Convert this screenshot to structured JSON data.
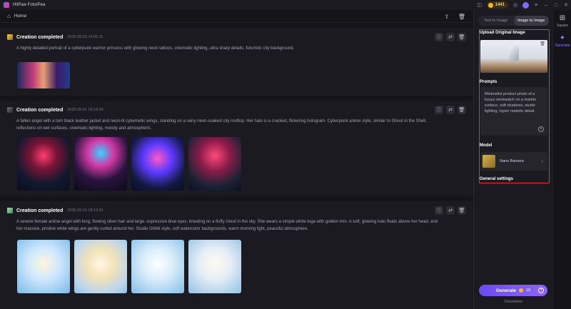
{
  "window": {
    "title": "HitPaw FotorPea",
    "credits": "1441"
  },
  "header": {
    "home_label": "Home"
  },
  "feed": {
    "cards": [
      {
        "title": "Creation completed",
        "time": "2025.09.03  14:55:11",
        "prompt": "A highly detailed portrait of a cyberpunk warrior princess with glowing neon tattoos, cinematic lighting, ultra sharp details, futuristic city background."
      },
      {
        "title": "Creation completed",
        "time": "2025.09.01  18:19:34",
        "prompt": "A fallen angel with a torn black leather jacket and neon-lit cybernetic wings, standing on a rainy neon-soaked city rooftop. Her halo is a cracked, flickering hologram. Cyberpunk anime style, similar to Ghost in the Shell, reflections on wet surfaces, cinematic lighting, moody and atmospheric."
      },
      {
        "title": "Creation completed",
        "time": "2025.09.01  18:19:01",
        "prompt": "A serene female anime angel with long, flowing silver hair and large, expressive blue eyes, kneeling on a fluffy cloud in the sky. She wears a simple white toga with golden trim. A soft, glowing halo floats above her head, and her massive, pristine white wings are gently curled around her. Studio Ghibli style, soft watercolor backgrounds, warm morning light, peaceful atmosphere."
      }
    ]
  },
  "panel": {
    "tabs": [
      "Text to Image",
      "Image to Image"
    ],
    "active_tab": "Image to Image",
    "upload_label": "Upload Original Image",
    "prompts_label": "Prompts",
    "prompt_text": "Minimalist product photo of a luxury wristwatch on a marble surface, soft shadows, studio lighting, hyper realistic detail.",
    "model_label": "Model",
    "model_name": "Nano Banana",
    "general_settings_label": "General settings",
    "generate_label": "Generate",
    "generate_cost": "16",
    "disclaimer": "Disclaimer"
  },
  "rail": {
    "items": [
      {
        "label": "Square",
        "icon": "grid-icon"
      },
      {
        "label": "Generate",
        "icon": "sparkle-icon"
      }
    ]
  },
  "colors": {
    "accent": "#8e63f7",
    "highlight_border": "#e0343a",
    "background": "#151419",
    "card": "#1b1a20"
  }
}
